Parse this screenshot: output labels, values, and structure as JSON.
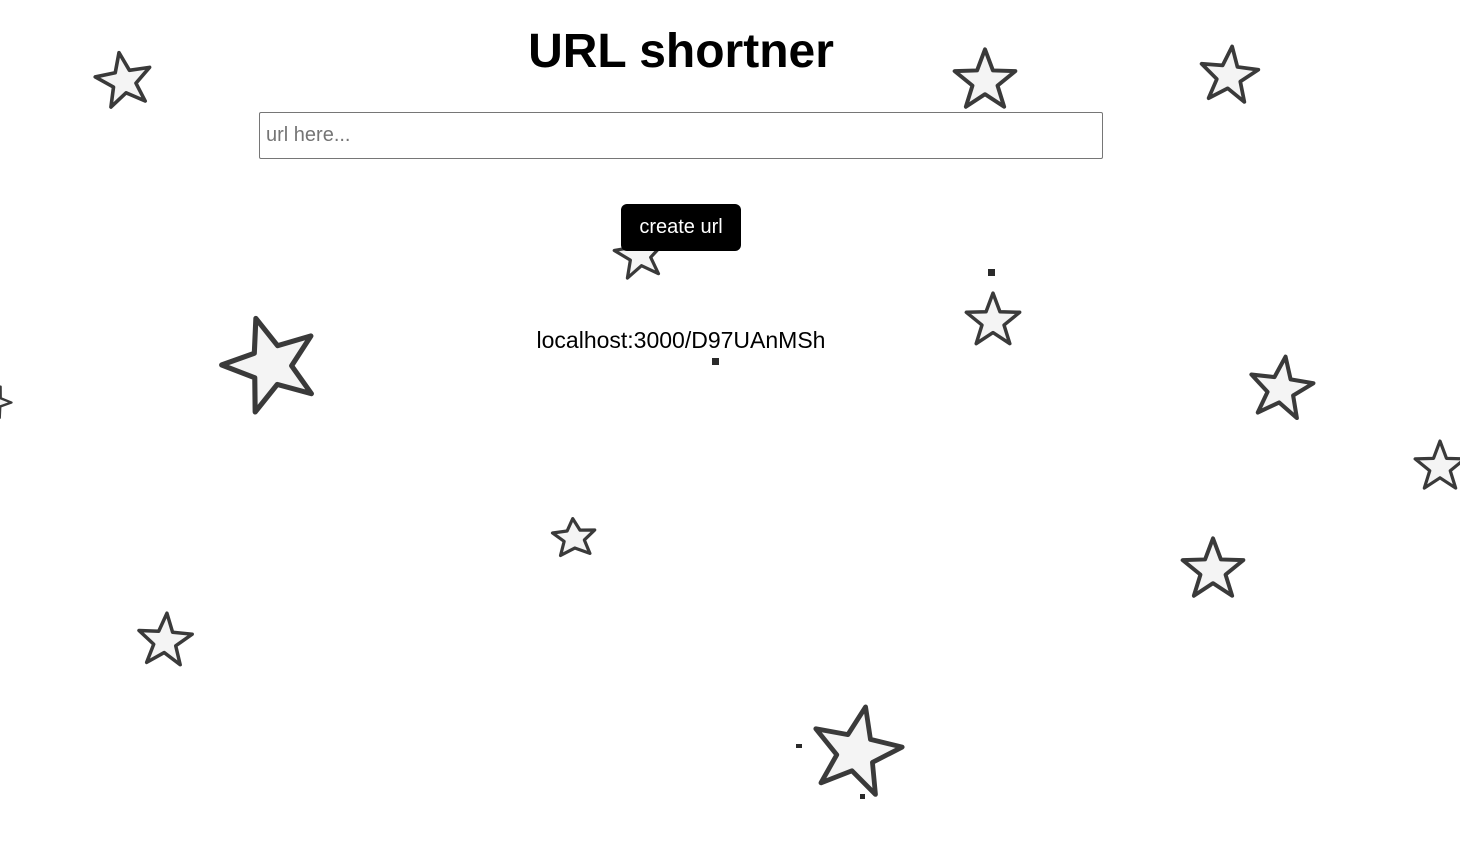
{
  "page": {
    "title": "URL shortner",
    "input": {
      "placeholder": "url here...",
      "value": ""
    },
    "create_button_label": "create url",
    "short_url": "localhost:3000/D97UAnMSh"
  },
  "decor": {
    "icon": "star-icon",
    "star_fill": "#f7f7f7",
    "star_outline": "#3a3a3a"
  }
}
